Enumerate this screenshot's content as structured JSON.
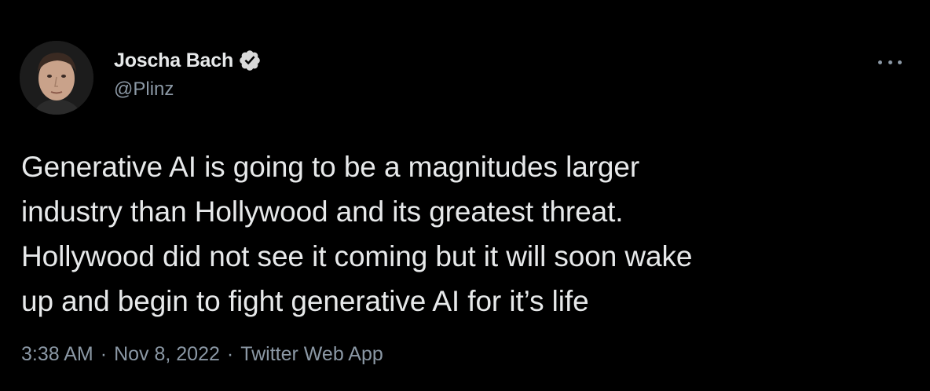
{
  "colors": {
    "background": "#000000",
    "text_primary": "#e7e9ea",
    "text_secondary": "#8b98a5",
    "verified_badge": "#d9d9d9"
  },
  "author": {
    "display_name": "Joscha Bach",
    "handle": "@Plinz",
    "verified": true,
    "verified_icon": "verified-badge-icon",
    "avatar_icon": "avatar-photo"
  },
  "tweet": {
    "text_lines": [
      "Generative AI is going to be a magnitudes larger",
      "industry than Hollywood and its greatest threat.",
      "Hollywood did not see it coming but it will soon wake",
      "up and begin to fight generative AI for it’s life"
    ],
    "time": "3:38 AM",
    "separator": "·",
    "date": "Nov 8, 2022",
    "source": "Twitter Web App"
  },
  "menu": {
    "icon": "more-options-icon"
  }
}
